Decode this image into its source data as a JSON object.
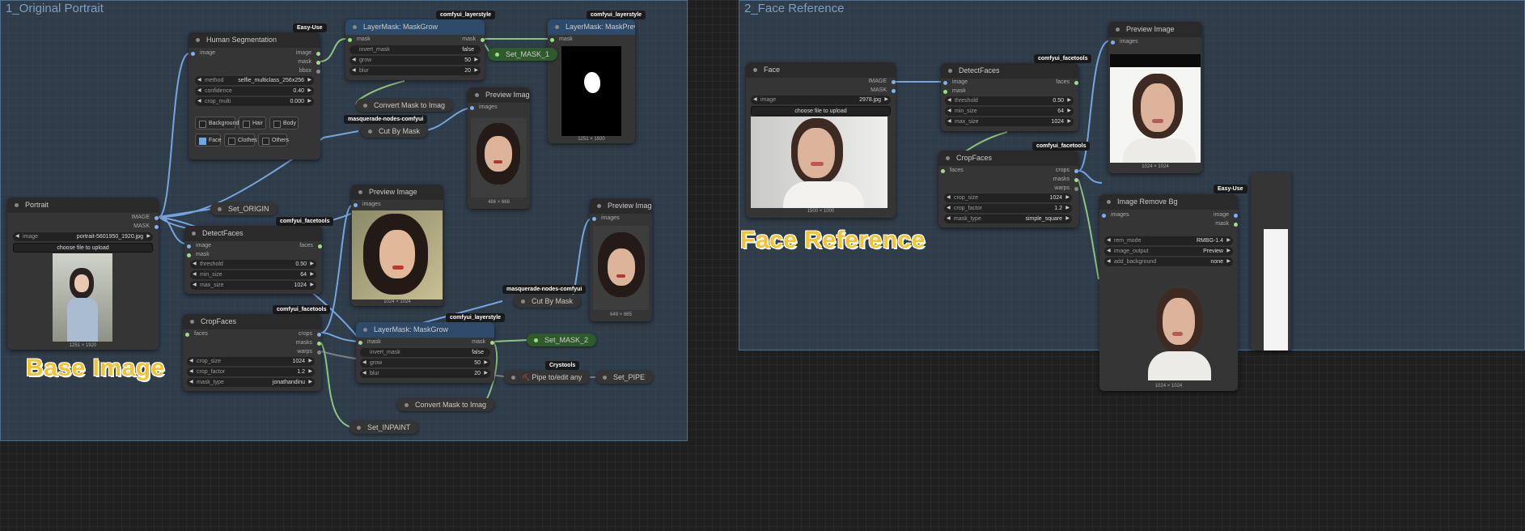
{
  "groups": {
    "original": "1_Original Portrait",
    "face_ref": "2_Face Reference"
  },
  "labels": {
    "base_image": "Base Image",
    "face_reference": "Face Reference"
  },
  "portrait": {
    "title": "Portrait",
    "out_image": "IMAGE",
    "out_mask": "MASK",
    "image_label": "image",
    "image_value": "portrait-5601950_1920.jpg",
    "upload": "choose file to upload",
    "dims": "1251 × 1920"
  },
  "human_seg": {
    "badge": "Easy-Use",
    "title": "Human Segmentation",
    "in_image": "image",
    "out_image": "image",
    "out_mask": "mask",
    "out_bbox": "bbox",
    "method_label": "method",
    "method_value": "selfie_multiclass_256x256",
    "confidence_label": "confidence",
    "confidence_value": "0.40",
    "crop_label": "crop_multi",
    "crop_value": "0.000",
    "classes": [
      "Background",
      "Hair",
      "Body",
      "Face",
      "Clothes",
      "Others"
    ]
  },
  "maskgrow1": {
    "badge": "comfyui_layerstyle",
    "title": "LayerMask: MaskGrow",
    "in_mask": "mask",
    "out_mask": "mask",
    "invert_label": "invert_mask",
    "invert_value": "false",
    "grow_label": "grow",
    "grow_value": "50",
    "blur_label": "blur",
    "blur_value": "20"
  },
  "maskpreview": {
    "badge": "comfyui_layerstyle",
    "title": "LayerMask: MaskPreview",
    "in_mask": "mask",
    "dims": "1251 × 1920"
  },
  "set_mask1": "Set_MASK_1",
  "convert1": "Convert Mask to Imag",
  "cutbymask1": {
    "badge": "masquerade-nodes-comfyui",
    "title": "Cut By Mask"
  },
  "preview1": {
    "title": "Preview Image",
    "in_images": "images",
    "dims": "486 × 666"
  },
  "set_origin": "Set_ORIGIN",
  "detect1": {
    "badge": "comfyui_facetools",
    "title": "DetectFaces",
    "in_image": "image",
    "in_mask": "mask",
    "out_faces": "faces",
    "threshold_label": "threshold",
    "threshold_value": "0.50",
    "minsize_label": "min_size",
    "minsize_value": "64",
    "maxsize_label": "max_size",
    "maxsize_value": "1024"
  },
  "preview2": {
    "title": "Preview Image",
    "in_images": "images",
    "dims": "1024 × 1024"
  },
  "crop1": {
    "badge": "comfyui_facetools",
    "title": "CropFaces",
    "in_faces": "faces",
    "out_crops": "crops",
    "out_masks": "masks",
    "out_warps": "warps",
    "cropsize_label": "crop_size",
    "cropsize_value": "1024",
    "cropfactor_label": "crop_factor",
    "cropfactor_value": "1.2",
    "masktype_label": "mask_type",
    "masktype_value": "jonathandinu"
  },
  "maskgrow2": {
    "badge": "comfyui_layerstyle",
    "title": "LayerMask: MaskGrow",
    "in_mask": "mask",
    "out_mask": "mask",
    "invert_label": "invert_mask",
    "invert_value": "false",
    "grow_label": "grow",
    "grow_value": "50",
    "blur_label": "blur",
    "blur_value": "20"
  },
  "cutbymask2": {
    "badge": "masquerade-nodes-comfyui",
    "title": "Cut By Mask"
  },
  "preview3": {
    "title": "Preview Image",
    "in_images": "images",
    "dims": "649 × 865"
  },
  "set_mask2": "Set_MASK_2",
  "pipe": {
    "badge": "Crystools",
    "title": "Pipe to/edit any"
  },
  "set_pipe": "Set_PIPE",
  "convert2": "Convert Mask to Imag",
  "set_inpaint": "Set_INPAINT",
  "face": {
    "title": "Face",
    "out_image": "IMAGE",
    "out_mask": "MASK",
    "image_label": "image",
    "image_value": "2978.jpg",
    "upload": "choose file to upload",
    "dims": "1500 × 1000"
  },
  "detect2": {
    "badge": "comfyui_facetools",
    "title": "DetectFaces",
    "in_image": "image",
    "in_mask": "mask",
    "out_faces": "faces",
    "threshold_label": "threshold",
    "threshold_value": "0.50",
    "minsize_label": "min_size",
    "minsize_value": "64",
    "maxsize_label": "max_size",
    "maxsize_value": "1024"
  },
  "crop2": {
    "badge": "comfyui_facetools",
    "title": "CropFaces",
    "in_faces": "faces",
    "out_crops": "crops",
    "out_masks": "masks",
    "out_warps": "warps",
    "cropsize_label": "crop_size",
    "cropsize_value": "1024",
    "cropfactor_label": "crop_factor",
    "cropfactor_value": "1.2",
    "masktype_label": "mask_type",
    "masktype_value": "simple_square"
  },
  "preview4": {
    "title": "Preview Image",
    "in_images": "images",
    "dims": "1024 × 1024"
  },
  "removebg": {
    "badge": "Easy-Use",
    "title": "Image Remove Bg",
    "in_images": "images",
    "out_image": "image",
    "out_mask": "mask",
    "rem_label": "rem_mode",
    "rem_value": "RMBG-1.4",
    "output_label": "image_output",
    "output_value": "Preview",
    "addbg_label": "add_background",
    "addbg_value": "none",
    "dims": "1024 × 1024"
  }
}
